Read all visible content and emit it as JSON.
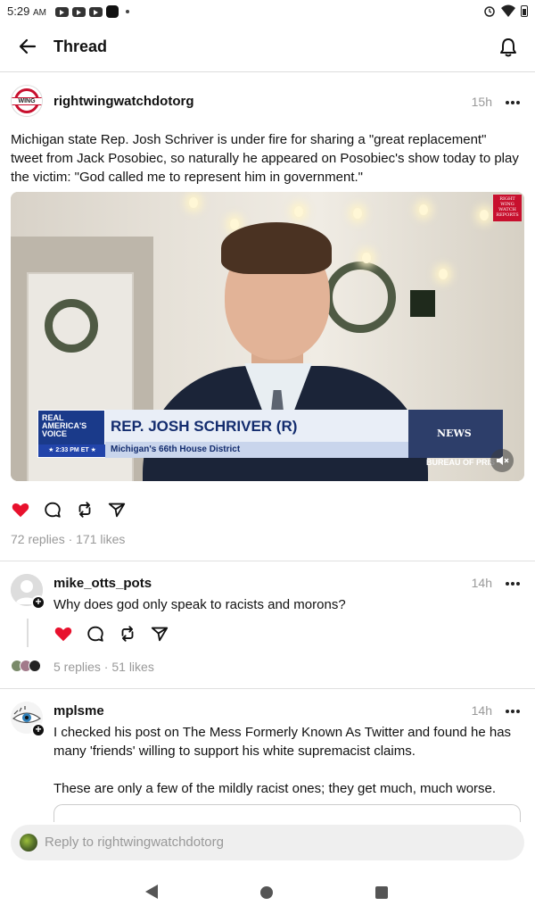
{
  "status_bar": {
    "time": "5:29",
    "ampm": "AM"
  },
  "header": {
    "title": "Thread"
  },
  "post": {
    "avatar_label": "WING",
    "username": "rightwingwatchdotorg",
    "time": "15h",
    "text": "Michigan state Rep. Josh Schriver is under fire for sharing a \"great replacement\" tweet from Jack Posobiec, so naturally he appeared on Posobiec's show today to play the victim: \"God called me to represent him in government.\"",
    "video": {
      "badge": "RIGHT WING WATCH REPORTS",
      "network": "REAL AMERICA'S VOICE",
      "airtime": "2:33 PM ET",
      "chyron_name": "REP. JOSH SCHRIVER (R)",
      "chyron_sub": "Michigan's 66th House District",
      "news_label": "NEWS",
      "bureau": "BUREAU OF PRIS"
    },
    "stats": "72 replies · 171 likes"
  },
  "replies": [
    {
      "username": "mike_otts_pots",
      "time": "14h",
      "text": "Why does god only speak to racists and morons?",
      "stats": "5 replies · 51 likes"
    },
    {
      "username": "mplsme",
      "time": "14h",
      "text": "I checked his post on The Mess Formerly Known As Twitter and found he has many 'friends' willing to support his white supremacist claims.",
      "text2": "These are only a few of the mildly racist ones; they get much, much worse."
    }
  ],
  "reply_input": {
    "placeholder": "Reply to rightwingwatchdotorg"
  },
  "colors": {
    "like_red": "#e8112d",
    "brand_red": "#c8102e",
    "muted": "#999999"
  }
}
